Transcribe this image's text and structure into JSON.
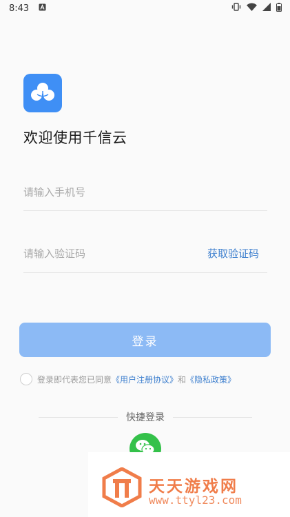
{
  "status_bar": {
    "time": "8:43",
    "icons": [
      "notification-a-icon",
      "vibrate-icon",
      "wifi-icon",
      "signal-icon",
      "battery-icon"
    ]
  },
  "app": {
    "welcome_title": "欢迎使用千信云",
    "logo_icon": "cloud-icon",
    "accent_color": "#3f8ff5"
  },
  "form": {
    "phone_placeholder": "请输入手机号",
    "phone_value": "",
    "code_placeholder": "请输入验证码",
    "code_value": "",
    "get_code_label": "获取验证码",
    "login_label": "登录"
  },
  "agreement": {
    "checked": false,
    "prefix": "登录即代表您已同意",
    "user_agreement": "《用户注册协议》",
    "and": "和",
    "privacy_policy": "《隐私政策》"
  },
  "quick_login": {
    "label": "快捷登录",
    "options": [
      "wechat-icon"
    ]
  },
  "watermark": {
    "title": "天天游戏网",
    "url": "www.ttyl23.com"
  }
}
